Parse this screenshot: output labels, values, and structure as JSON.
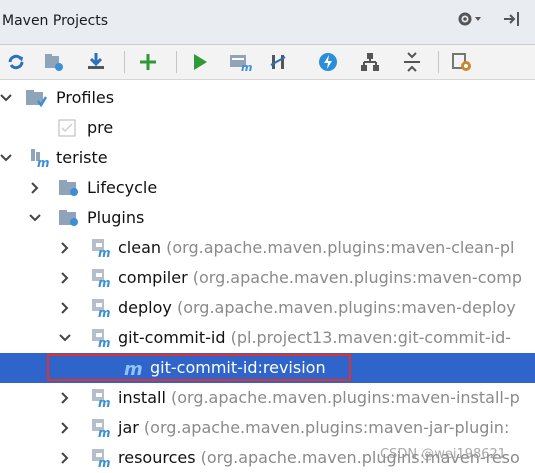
{
  "window": {
    "title": "Maven Projects"
  },
  "toolbar": {
    "tools": [
      "reimport-icon",
      "generate-sources-icon",
      "download-icon",
      "add-icon",
      "run-icon",
      "execute-goal-icon",
      "toggle-offline-icon",
      "skip-tests-icon",
      "diagrams-icon",
      "collapse-all-icon",
      "settings-icon"
    ]
  },
  "tree": {
    "profiles": {
      "label": "Profiles",
      "items": [
        {
          "label": "pre",
          "checked": false
        }
      ]
    },
    "project": {
      "label": "teriste"
    },
    "lifecycle": {
      "label": "Lifecycle"
    },
    "plugins": {
      "label": "Plugins",
      "items": [
        {
          "name": "clean",
          "coords": "(org.apache.maven.plugins:maven-clean-pl"
        },
        {
          "name": "compiler",
          "coords": "(org.apache.maven.plugins:maven-comp"
        },
        {
          "name": "deploy",
          "coords": "(org.apache.maven.plugins:maven-deploy"
        },
        {
          "name": "git-commit-id",
          "coords": "(pl.project13.maven:git-commit-id-"
        },
        {
          "name": "install",
          "coords": "(org.apache.maven.plugins:maven-install-p"
        },
        {
          "name": "jar",
          "coords": "(org.apache.maven.plugins:maven-jar-plugin:"
        },
        {
          "name": "resources",
          "coords": "(org.apache.maven.plugins:maven-reso"
        }
      ],
      "goal": {
        "label": "git-commit-id:revision"
      }
    }
  },
  "watermark": "CSDN @wei198621"
}
